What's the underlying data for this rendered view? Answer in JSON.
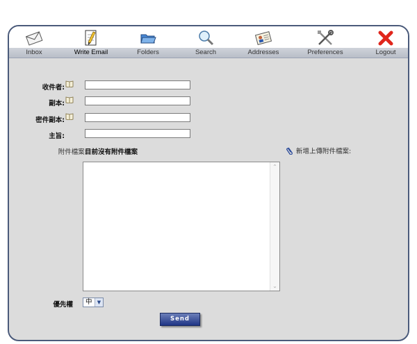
{
  "nav": {
    "items": [
      {
        "label": "Inbox",
        "icon": "envelope-icon"
      },
      {
        "label": "Write Email",
        "icon": "pencil-paper-icon"
      },
      {
        "label": "Folders",
        "icon": "folder-icon"
      },
      {
        "label": "Search",
        "icon": "magnifier-icon"
      },
      {
        "label": "Addresses",
        "icon": "address-card-icon"
      },
      {
        "label": "Preferences",
        "icon": "tools-icon"
      },
      {
        "label": "Logout",
        "icon": "red-x-icon"
      }
    ],
    "active": "Write Email"
  },
  "form": {
    "to_label": "收件者:",
    "cc_label": "副本:",
    "bcc_label": "密件副本:",
    "subject_label": "主旨:",
    "to_value": "",
    "cc_value": "",
    "bcc_value": "",
    "subject_value": "",
    "attachments_label": "附件檔案:",
    "attachments_value": "目前沒有附件檔案",
    "upload_link": "新增上傳附件檔案:",
    "body_value": "",
    "priority_label": "優先權",
    "priority_value": "中",
    "send_label": "Send"
  },
  "colors": {
    "frame_border": "#4a5a7a",
    "frame_bg": "#dcdcdc",
    "send_button": "#1f3586",
    "logout_icon": "#e0261c"
  }
}
